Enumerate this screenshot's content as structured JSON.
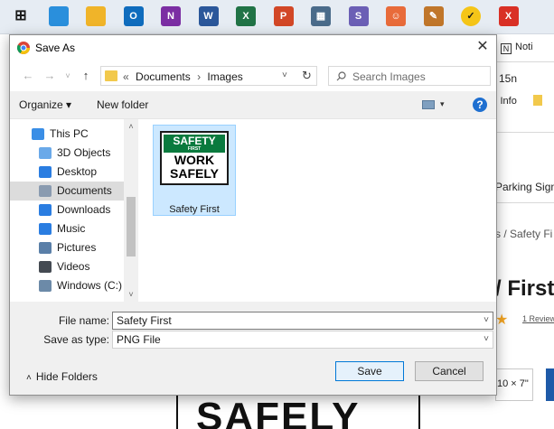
{
  "taskbar": {
    "icons": [
      {
        "name": "start-icon",
        "glyph": "⊞",
        "color": "#1a1a1a"
      },
      {
        "name": "edge-icon",
        "glyph": "",
        "color": "#2a8fdc"
      },
      {
        "name": "file-explorer-icon",
        "glyph": "",
        "color": "#f0b429"
      },
      {
        "name": "outlook-icon",
        "glyph": "O",
        "color": "#0f6cbd"
      },
      {
        "name": "onenote-icon",
        "glyph": "N",
        "color": "#7b2ea3"
      },
      {
        "name": "word-icon",
        "glyph": "W",
        "color": "#2b579a"
      },
      {
        "name": "excel-icon",
        "glyph": "X",
        "color": "#217346"
      },
      {
        "name": "powerpoint-icon",
        "glyph": "P",
        "color": "#d24726"
      },
      {
        "name": "calculator-icon",
        "glyph": "▦",
        "color": "#4a6b8a"
      },
      {
        "name": "skype-icon",
        "glyph": "S",
        "color": "#6b5fb5"
      },
      {
        "name": "support-icon",
        "glyph": "☺",
        "color": "#e86b3a"
      },
      {
        "name": "paint-icon",
        "glyph": "✎",
        "color": "#c0762a"
      },
      {
        "name": "norton-icon",
        "glyph": "✓",
        "color": "#f5c518"
      },
      {
        "name": "pdf-icon",
        "glyph": "X",
        "color": "#d93025"
      }
    ]
  },
  "dialog": {
    "title": "Save As",
    "address": {
      "separator": "«",
      "path": [
        "Documents",
        "Images"
      ]
    },
    "search": {
      "placeholder": "Search Images"
    },
    "toolbar": {
      "organize": "Organize ▾",
      "new_folder": "New folder"
    },
    "nav_items": [
      {
        "label": "This PC",
        "icon": "this-pc-icon",
        "color": "#3a8ee6",
        "selected": false
      },
      {
        "label": "3D Objects",
        "icon": "3d-objects-icon",
        "color": "#6aa9e9",
        "selected": false
      },
      {
        "label": "Desktop",
        "icon": "desktop-icon",
        "color": "#2a7de1",
        "selected": false
      },
      {
        "label": "Documents",
        "icon": "documents-icon",
        "color": "#8a9bb0",
        "selected": true
      },
      {
        "label": "Downloads",
        "icon": "downloads-icon",
        "color": "#2a7de1",
        "selected": false
      },
      {
        "label": "Music",
        "icon": "music-icon",
        "color": "#2a7de1",
        "selected": false
      },
      {
        "label": "Pictures",
        "icon": "pictures-icon",
        "color": "#5a7fa8",
        "selected": false
      },
      {
        "label": "Videos",
        "icon": "videos-icon",
        "color": "#444a52",
        "selected": false
      },
      {
        "label": "Windows (C:)",
        "icon": "drive-icon",
        "color": "#6c8aa8",
        "selected": false
      }
    ],
    "files": [
      {
        "name": "Safety First",
        "thumbnail": {
          "line1": "SAFETY",
          "line2": "FIRST",
          "line3": "WORK",
          "line4": "SAFELY"
        }
      }
    ],
    "file_name_label": "File name:",
    "file_name_value": "Safety First",
    "save_as_type_label": "Save as type:",
    "save_as_type_value": "PNG File",
    "hide_folders": "Hide Folders",
    "save_button": "Save",
    "cancel_button": "Cancel"
  },
  "background": {
    "tab_label": "Noti",
    "text_15n": "15n",
    "text_info": "l Info",
    "text_parking": "Parking Signs",
    "text_breadcrumb": "s / Safety Fi",
    "text_first": "/ First",
    "text_review": "1 Review",
    "text_size": "10 × 7\"",
    "big_sign_text": "SAFELY"
  },
  "colors": {
    "accent": "#0078d7",
    "selection": "#cce8ff",
    "sign_green": "#0a7a3e"
  }
}
